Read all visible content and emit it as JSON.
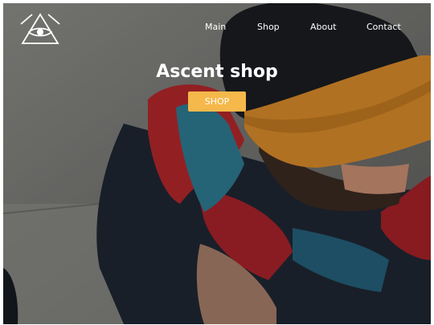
{
  "nav": {
    "items": [
      {
        "label": "Main"
      },
      {
        "label": "Shop"
      },
      {
        "label": "About"
      },
      {
        "label": "Contact"
      }
    ]
  },
  "hero": {
    "title": "Ascent shop",
    "button_label": "SHOP",
    "image": "hero-photo-person-in-cap-and-windbreaker"
  },
  "colors": {
    "accent": "#f5b84a",
    "nav_text": "#ffffff"
  },
  "icons": {
    "logo": "triangle-eye-logo-icon"
  }
}
